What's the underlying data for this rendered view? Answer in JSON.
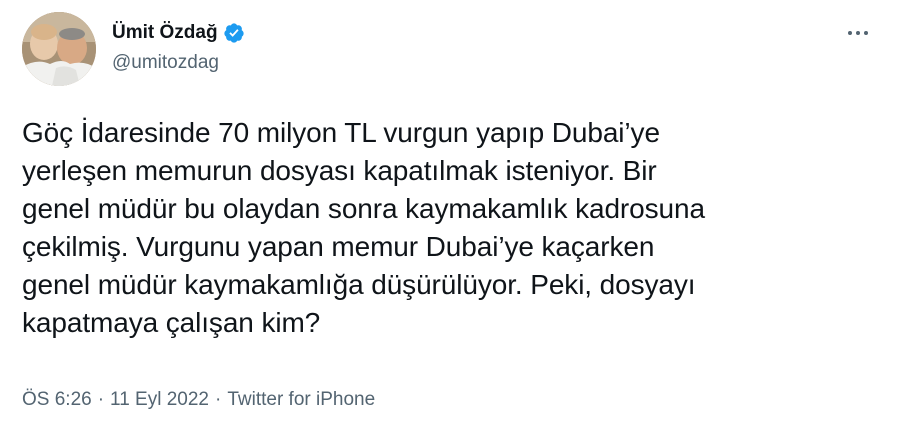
{
  "author": {
    "display_name": "Ümit Özdağ",
    "handle": "@umitozdag",
    "verified": true,
    "verified_color": "#1d9bf0"
  },
  "tweet": {
    "text": "Göç İdaresinde 70 milyon TL vurgun yapıp Dubai’ye\nyerleşen memurun dosyası kapatılmak isteniyor. Bir\ngenel müdür bu olaydan sonra kaymakamlık kadrosuna\nçekilmiş. Vurgunu yapan memur Dubai’ye kaçarken\ngenel müdür kaymakamlığa düşürülüyor. Peki, dosyayı\nkapatmaya çalışan kim?",
    "time": "ÖS 6:26",
    "date": "11 Eyl 2022",
    "source": "Twitter for iPhone",
    "separator": "·"
  },
  "icons": {
    "more": "more-horizontal-icon",
    "verified": "verified-badge-icon"
  },
  "colors": {
    "text": "#0f1419",
    "secondary": "#536471",
    "accent": "#1d9bf0"
  }
}
